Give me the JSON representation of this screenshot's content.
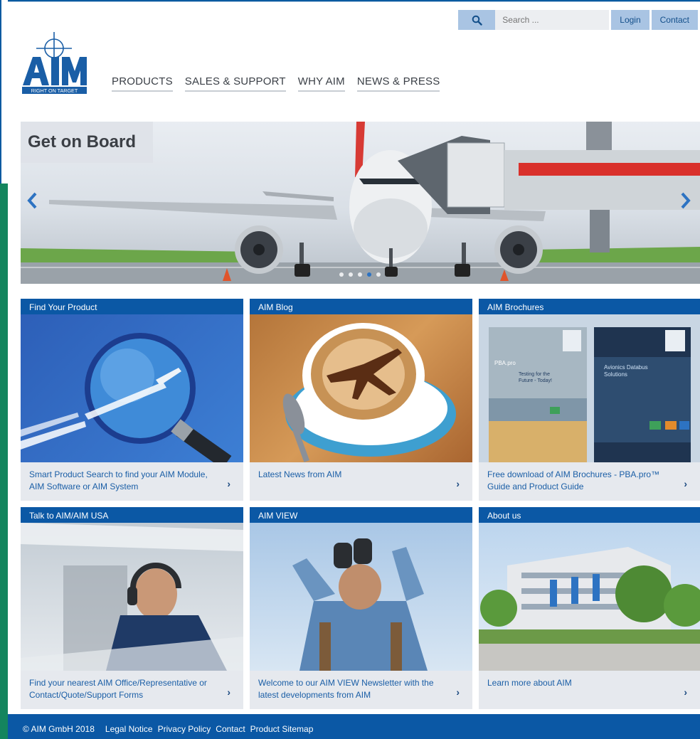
{
  "topbar": {
    "search_placeholder": "Search ...",
    "login_label": "Login",
    "contact_label": "Contact"
  },
  "logo": {
    "text": "AIM",
    "tagline": "RIGHT ON TARGET"
  },
  "nav": {
    "items": [
      {
        "label": "PRODUCTS"
      },
      {
        "label": "SALES & SUPPORT"
      },
      {
        "label": "WHY AIM"
      },
      {
        "label": "NEWS & PRESS"
      }
    ]
  },
  "hero": {
    "title": "Get on Board",
    "prev_icon": "chevron-left-icon",
    "next_icon": "chevron-right-icon",
    "slide_count": 5,
    "active_slide": 4
  },
  "tiles": [
    {
      "header": "Find Your Product",
      "text": "Smart Product Search to find your AIM Module, AIM Software or AIM System"
    },
    {
      "header": "AIM Blog",
      "text": "Latest News from AIM"
    },
    {
      "header": "AIM Brochures",
      "text": "Free download of AIM Brochures - PBA.pro™ Guide and Product Guide"
    },
    {
      "header": "Talk to AIM/AIM USA",
      "text": "Find your nearest AIM Office/Representative or Contact/Quote/Support Forms"
    },
    {
      "header": "AIM VIEW",
      "text": "Welcome to our AIM VIEW Newsletter with the latest developments from AIM"
    },
    {
      "header": "About us",
      "text": "Learn more about AIM"
    }
  ],
  "brochures": {
    "left": {
      "brand": "PBA.pro",
      "headline": "Testing for the Future - Today!"
    },
    "right": {
      "headline": "Avionics Databus Solutions"
    }
  },
  "footer": {
    "copyright": "© AIM GmbH 2018",
    "links": [
      {
        "label": "Legal Notice"
      },
      {
        "label": "Privacy Policy"
      },
      {
        "label": "Contact"
      },
      {
        "label": "Product Sitemap"
      }
    ]
  },
  "colors": {
    "brand_blue": "#0b58a5",
    "link_blue": "#1a5ea6",
    "green_strip": "#14855e",
    "tile_footer_bg": "#e6e9ee"
  }
}
